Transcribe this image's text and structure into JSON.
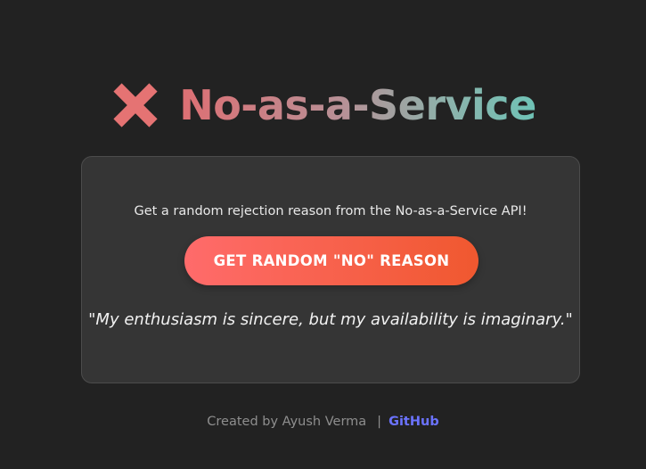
{
  "header": {
    "icon": "cross-mark-icon",
    "title": "No-as-a-Service"
  },
  "card": {
    "subtitle": "Get a random rejection reason from the No-as-a-Service API!",
    "button_label": "GET RANDOM \"NO\" REASON",
    "quote": "\"My enthusiasm is sincere, but my availability is imaginary.\""
  },
  "footer": {
    "credit": "Created by Ayush Verma",
    "separator": "|",
    "link_label": "GitHub"
  },
  "colors": {
    "background": "#222222",
    "card": "#353535",
    "icon": "#e57373",
    "button_start": "#ff6b6b",
    "button_end": "#f0582f",
    "link": "#6b73ff"
  }
}
